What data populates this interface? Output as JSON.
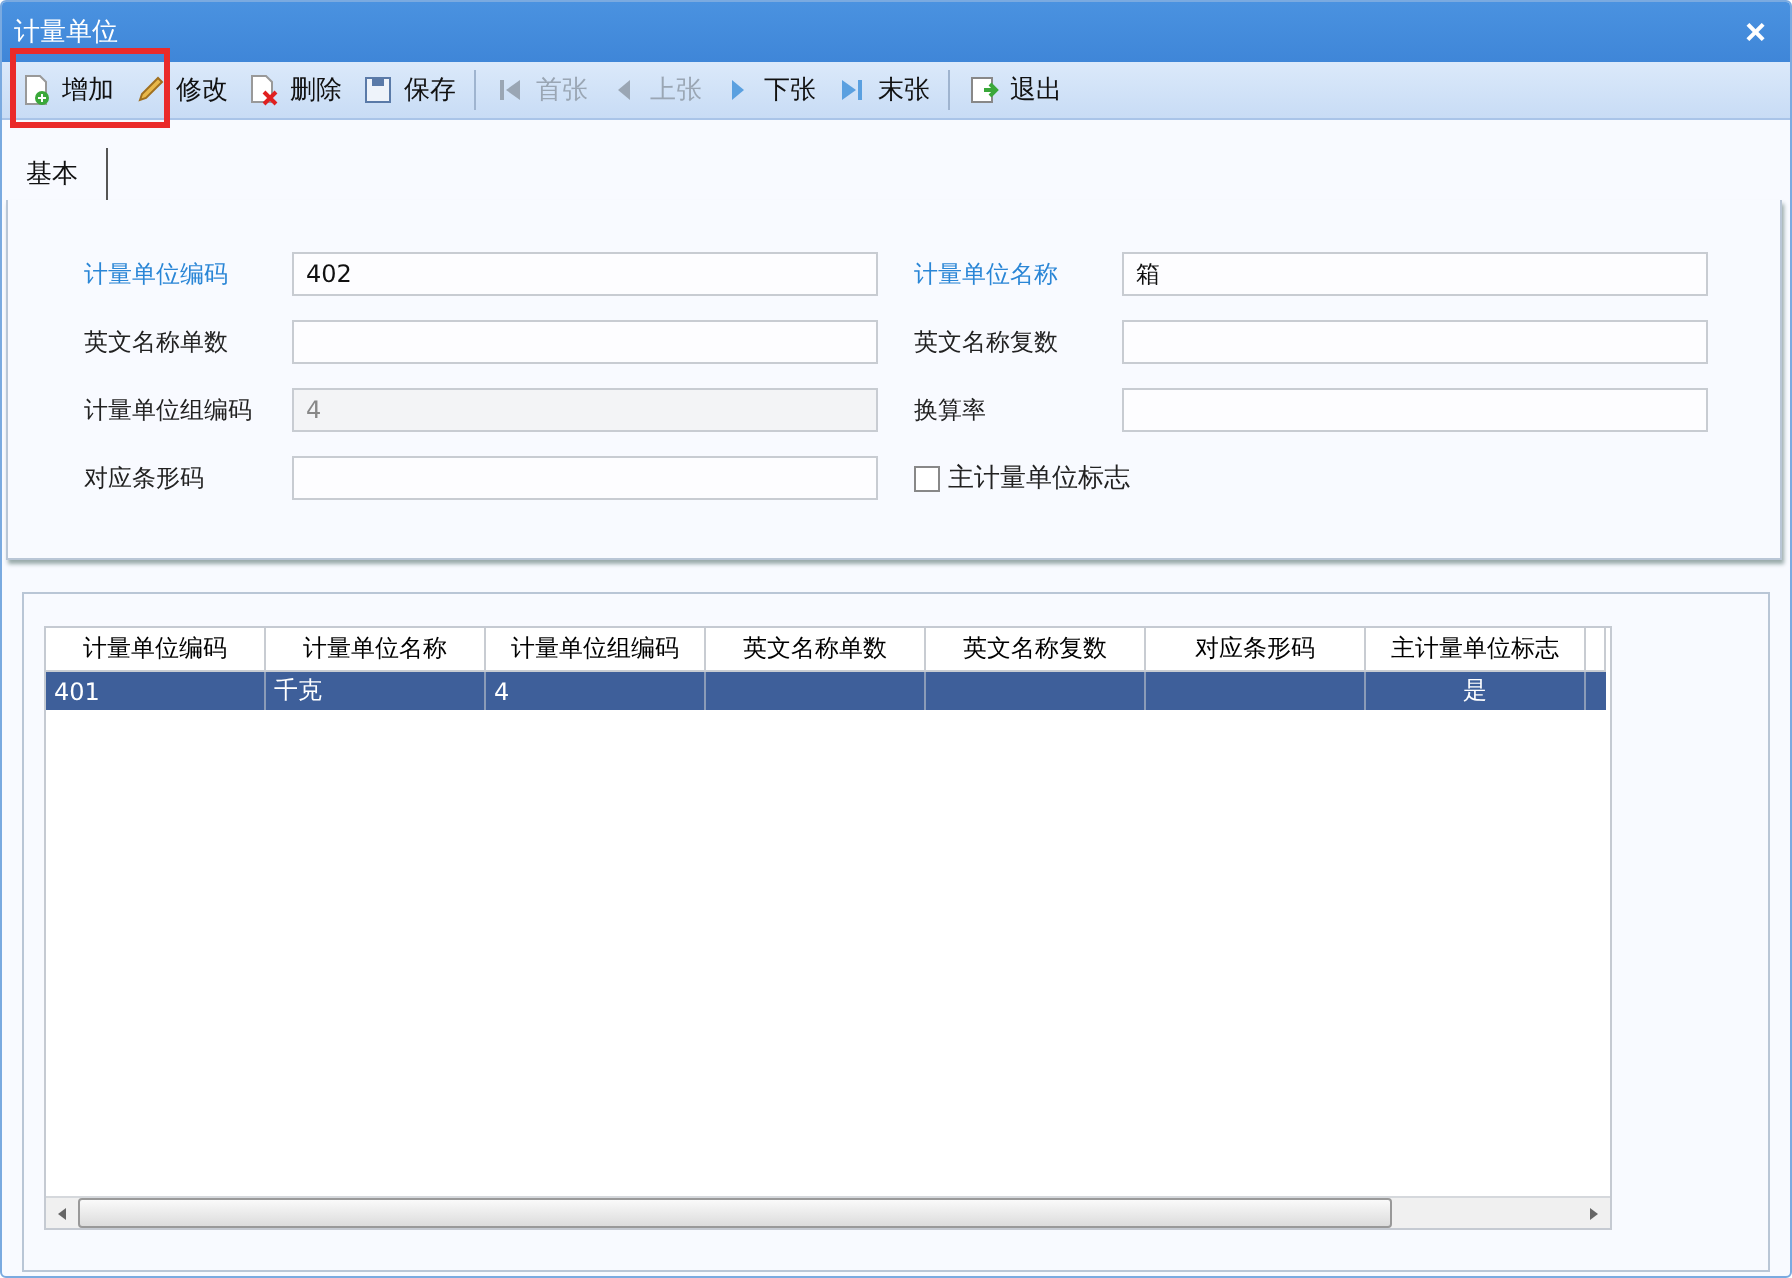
{
  "window": {
    "title": "计量单位",
    "close": "×"
  },
  "toolbar": [
    {
      "kind": "add",
      "label": "增加",
      "disabled": false,
      "highlighted": true
    },
    {
      "kind": "edit",
      "label": "修改",
      "disabled": false,
      "highlighted": false
    },
    {
      "kind": "delete",
      "label": "删除",
      "disabled": false,
      "highlighted": false
    },
    {
      "kind": "save",
      "label": "保存",
      "disabled": false,
      "highlighted": false
    },
    {
      "kind": "first",
      "label": "首张",
      "disabled": true,
      "highlighted": false
    },
    {
      "kind": "prev",
      "label": "上张",
      "disabled": true,
      "highlighted": false
    },
    {
      "kind": "next",
      "label": "下张",
      "disabled": false,
      "highlighted": false
    },
    {
      "kind": "last",
      "label": "末张",
      "disabled": false,
      "highlighted": false
    },
    {
      "kind": "exit",
      "label": "退出",
      "disabled": false,
      "highlighted": false
    }
  ],
  "tabs": [
    {
      "label": "基本",
      "selected": true
    }
  ],
  "form": {
    "fields": [
      {
        "label": "计量单位编码",
        "value": "402",
        "required": true,
        "disabled": false
      },
      {
        "label": "计量单位名称",
        "value": "箱",
        "required": true,
        "disabled": false
      },
      {
        "label": "英文名称单数",
        "required": false
      },
      {
        "label": "英文名称复数",
        "required": false
      },
      {
        "label": "计量单位组编码",
        "value": "4",
        "required": false,
        "disabled": true
      },
      {
        "label": "换算率",
        "required": false
      },
      {
        "label": "对应条形码",
        "required": false
      }
    ],
    "checkbox": {
      "label": "主计量单位标志",
      "checked": false
    }
  },
  "table": {
    "columns": [
      "计量单位编码",
      "计量单位名称",
      "计量单位组编码",
      "英文名称单数",
      "英文名称复数",
      "对应条形码",
      "主计量单位标志"
    ],
    "rows": [
      {
        "cells": [
          "401",
          "千克",
          "4",
          "",
          "",
          "",
          "是"
        ],
        "selected": true
      }
    ]
  }
}
